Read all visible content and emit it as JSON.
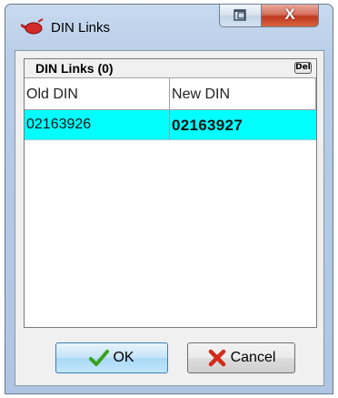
{
  "window": {
    "title": "DIN Links",
    "icons": {
      "app": "pill-icon",
      "restore": "restore-icon",
      "close": "close-icon"
    },
    "close_glyph": "X"
  },
  "panel": {
    "title": "DIN Links (0)",
    "del_label": "Del"
  },
  "grid": {
    "columns": [
      "Old DIN",
      "New DIN"
    ],
    "rows": [
      {
        "old_din": "02163926",
        "new_din": "02163927",
        "selected": true
      }
    ]
  },
  "buttons": {
    "ok_label": "OK",
    "cancel_label": "Cancel",
    "ok_icon": "checkmark-icon",
    "cancel_icon": "x-icon"
  },
  "colors": {
    "selected_row": "#00ffff",
    "ok_check": "#3aa01e",
    "cancel_x": "#d42a1a",
    "close_button": "#c0391f"
  }
}
